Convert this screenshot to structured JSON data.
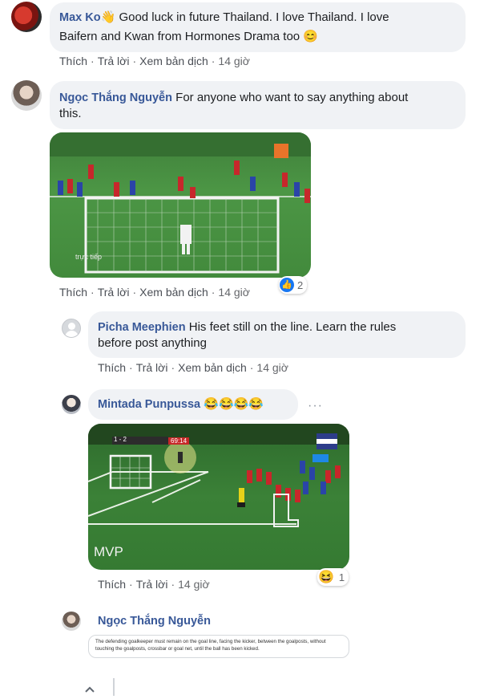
{
  "comments": [
    {
      "author": "Max Ko",
      "text_line1": "Good luck in future Thailand. I love Thailand. I love",
      "text_line2": "Baifern and Kwan from Hormones Drama too",
      "emoji_wave": "👋",
      "emoji_smile": "😊",
      "actions": {
        "like": "Thích",
        "reply": "Trả lời",
        "translate": "Xem bản dịch",
        "time": "14 giờ"
      }
    },
    {
      "author": "Ngọc Thắng Nguyễn",
      "text_line1": "For anyone who want to say anything about",
      "text_line2": "this.",
      "media_caption": "trực tiếp",
      "reaction_count": "2",
      "actions": {
        "like": "Thích",
        "reply": "Trả lời",
        "translate": "Xem bản dịch",
        "time": "14 giờ"
      }
    },
    {
      "author": "Picha Meephien",
      "text_line1": "His feet still on the line. Learn the rules",
      "text_line2": "before post anything",
      "actions": {
        "like": "Thích",
        "reply": "Trả lời",
        "translate": "Xem bản dịch",
        "time": "14 giờ"
      }
    },
    {
      "author": "Mintada Punpussa",
      "emojis": "😂😂😂😂",
      "more": "···",
      "media_caption": "MVP",
      "score": "1 - 2",
      "clock": "69:14",
      "reaction_emoji": "😆",
      "reaction_count": "1",
      "actions": {
        "like": "Thích",
        "reply": "Trả lời",
        "time": "14 giờ"
      }
    },
    {
      "author": "Ngọc Thắng Nguyễn",
      "rule_text": "The defending goalkeeper must remain on the goal line, facing the kicker, between the goalposts, without touching the goalposts, crossbar or goal net, until the ball has been kicked."
    }
  ],
  "footer": {
    "collapse_icon": "chevron-up-icon"
  },
  "colors": {
    "author": "#385898",
    "bubble": "#f0f2f5",
    "pitch": "#3f8a3a",
    "like_blue": "#1877f2"
  }
}
